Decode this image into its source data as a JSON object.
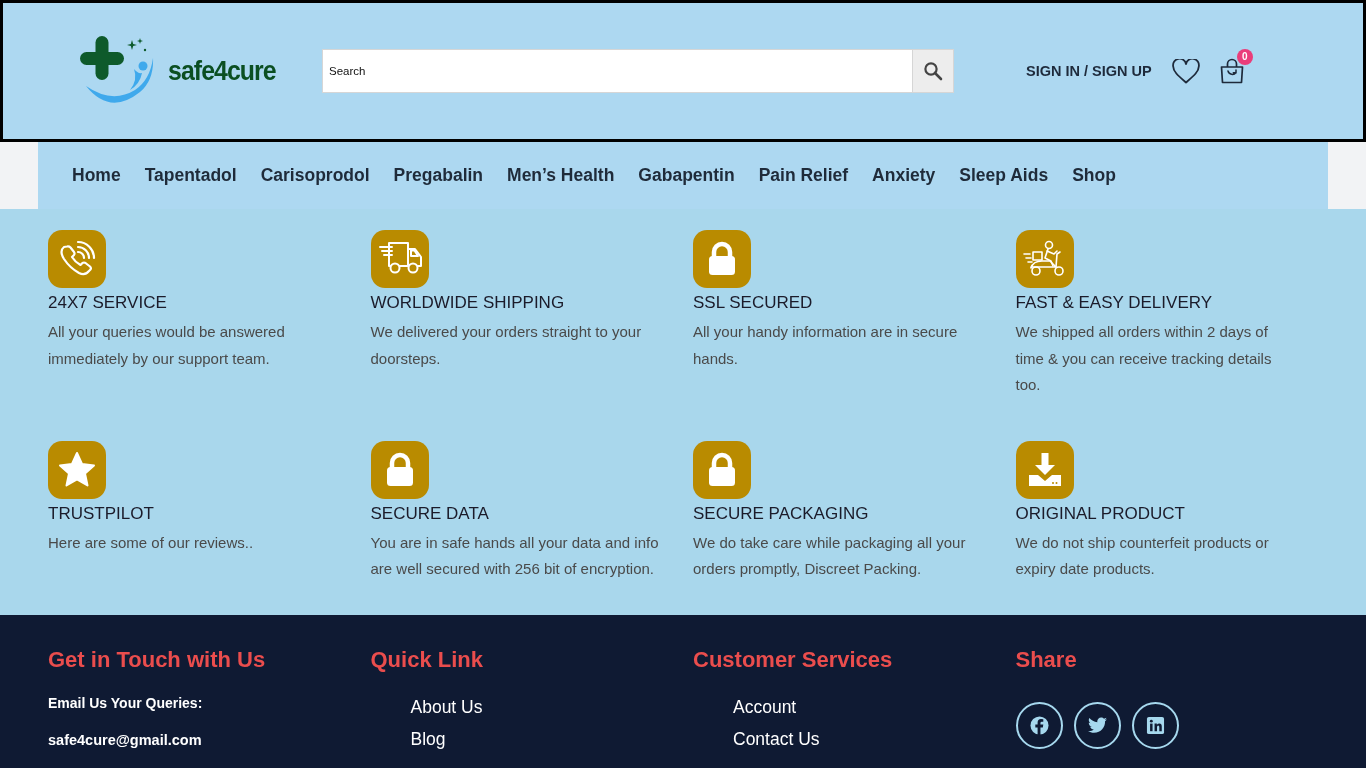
{
  "header": {
    "logo_text": "safe4cure",
    "search": {
      "placeholder": "Search"
    },
    "account_link": "SIGN IN / SIGN UP",
    "cart": {
      "count": "0"
    }
  },
  "nav": {
    "items": [
      "Home",
      "Tapentadol",
      "Carisoprodol",
      "Pregabalin",
      "Men’s Health",
      "Gabapentin",
      "Pain Relief",
      "Anxiety",
      "Sleep Aids",
      "Shop"
    ]
  },
  "features": [
    {
      "kind": "phone",
      "title": "24X7 SERVICE",
      "text": "All your queries would be answered immediately by our support team."
    },
    {
      "kind": "truck",
      "title": "WORLDWIDE SHIPPING",
      "text": "We delivered your orders straight to your doorsteps."
    },
    {
      "kind": "lock",
      "title": "SSL SECURED",
      "text": "All your handy information are in secure hands."
    },
    {
      "kind": "scooter",
      "title": "FAST & EASY DELIVERY",
      "text": "We shipped all orders within 2 days of time & you can receive tracking details too."
    },
    {
      "kind": "star",
      "title": "TRUSTPILOT",
      "text": "Here are some of our reviews.."
    },
    {
      "kind": "lock",
      "title": "SECURE DATA",
      "text": "You are in safe hands all your data and info are well secured with 256 bit of encryption."
    },
    {
      "kind": "lock",
      "title": "SECURE PACKAGING",
      "text": "We do take care while packaging all your orders promptly, Discreet Packing."
    },
    {
      "kind": "download",
      "title": "ORIGINAL PRODUCT",
      "text": "We do not ship counterfeit products or expiry date products."
    }
  ],
  "footer": {
    "contact": {
      "heading": "Get in Touch with Us",
      "label": "Email Us Your Queries:",
      "email": "safe4cure@gmail.com"
    },
    "quick_links": {
      "heading": "Quick Link",
      "items": [
        "About Us",
        "Blog"
      ]
    },
    "customer_services": {
      "heading": "Customer Services",
      "items": [
        "Account",
        "Contact Us"
      ]
    },
    "share": {
      "heading": "Share",
      "buttons": [
        {
          "kind": "facebook"
        },
        {
          "kind": "twitter"
        },
        {
          "kind": "linkedin"
        }
      ]
    }
  }
}
